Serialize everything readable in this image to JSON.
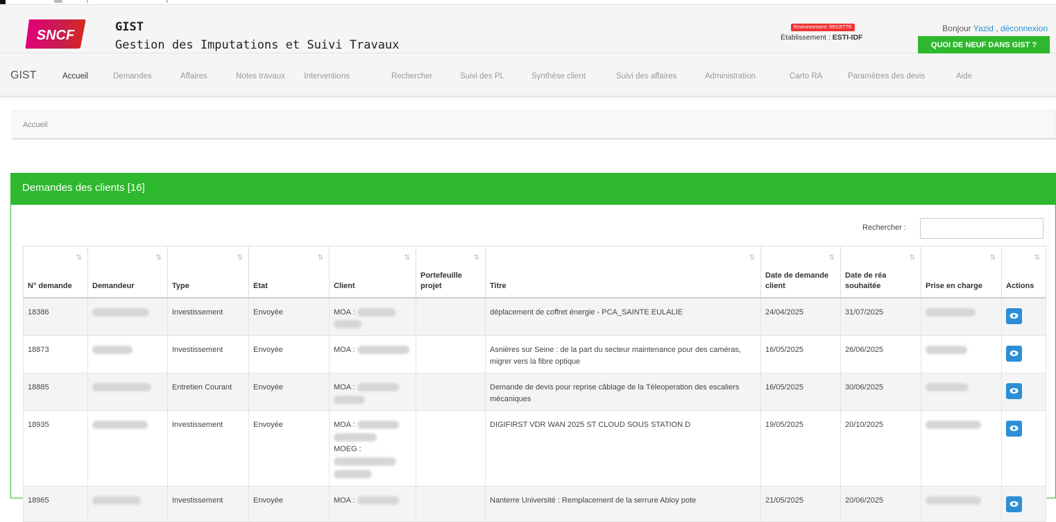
{
  "header": {
    "logo_text": "SNCF",
    "app_title": "GIST",
    "app_subtitle": "Gestion des Imputations et Suivi Travaux",
    "env_badge": "Environnement: RECETTE",
    "etablissement_label": "Établissement : ",
    "etablissement_value": "ESTI-IDF",
    "greeting_prefix": "Bonjour ",
    "user_name": "Yazid",
    "greeting_sep": " , ",
    "logout_label": "déconnexion",
    "news_button": "QUOI DE NEUF DANS GIST ?"
  },
  "nav": {
    "brand": "GIST",
    "items": [
      "Accueil",
      "Demandes",
      "Affaires",
      "Notes travaux",
      "Interventions",
      "Rechercher",
      "Suivi des PL",
      "Synthèse client",
      "Suivi des affaires",
      "Administration",
      "Carto RA",
      "Paramètres des devis",
      "Aide"
    ],
    "active": "Accueil"
  },
  "breadcrumb": {
    "current": "Accueil"
  },
  "panel": {
    "title": "Demandes des clients [16]",
    "search_label": "Rechercher :",
    "search_value": ""
  },
  "table": {
    "columns": [
      "N° demande",
      "Demandeur",
      "Type",
      "Etat",
      "Client",
      "Portefeuille projet",
      "Titre",
      "Date de demande client",
      "Date de réa souhaitée",
      "Prise en charge",
      "Actions"
    ],
    "rows": [
      {
        "num": "18386",
        "type": "Investissement",
        "etat": "Envoyée",
        "client": "MOA :",
        "titre": "déplacement de coffret énergie - PCA_SAINTE EULALIE",
        "date_demande": "24/04/2025",
        "date_rea": "31/07/2025"
      },
      {
        "num": "18873",
        "type": "Investissement",
        "etat": "Envoyée",
        "client": "MOA :",
        "titre": "Asnières sur Seine : de la part du secteur maintenance pour des caméras, migrer vers la fibre optique",
        "date_demande": "16/05/2025",
        "date_rea": "26/06/2025"
      },
      {
        "num": "18885",
        "type": "Entretien Courant",
        "etat": "Envoyée",
        "client": "MOA :",
        "titre": "Demande de devis pour reprise câblage de la Téleoperation des escaliers mécaniques",
        "date_demande": "16/05/2025",
        "date_rea": "30/06/2025"
      },
      {
        "num": "18935",
        "type": "Investissement",
        "etat": "Envoyée",
        "client": "MOA :",
        "client_extra": "MOEG :",
        "titre": "DIGIFIRST VDR WAN 2025 ST CLOUD SOUS STATION D",
        "date_demande": "19/05/2025",
        "date_rea": "20/10/2025"
      },
      {
        "num": "18965",
        "type": "Investissement",
        "etat": "Envoyée",
        "client": "MOA :",
        "titre": "Nanterre Université : Remplacement de la serrure Abloy pote",
        "date_demande": "21/05/2025",
        "date_rea": "20/06/2025"
      }
    ]
  },
  "colors": {
    "green": "#2eb82e",
    "blue": "#2a8fd6",
    "red": "#e33333"
  }
}
